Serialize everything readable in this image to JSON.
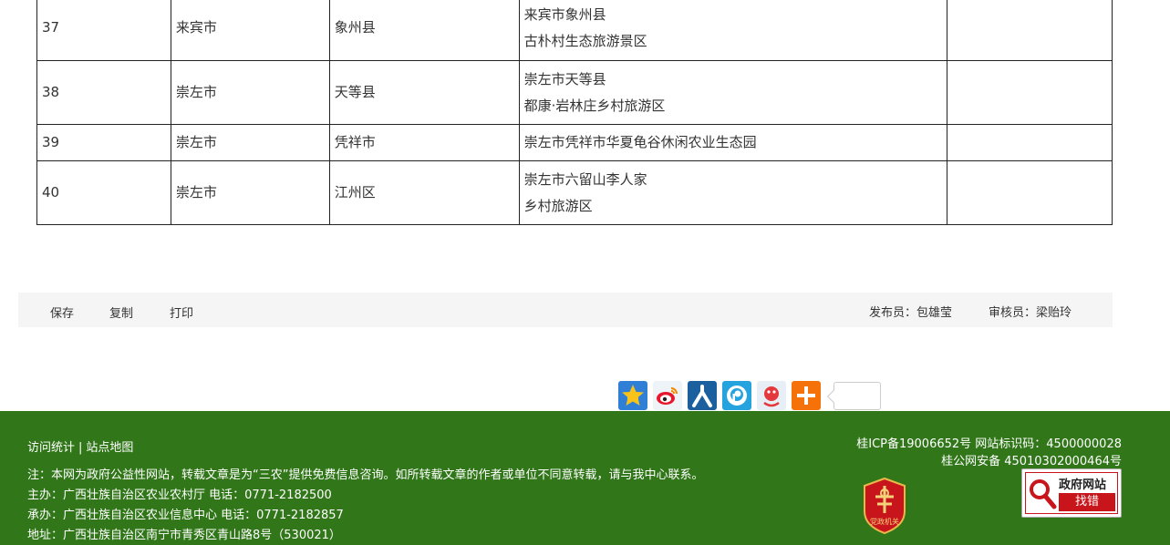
{
  "table": {
    "rows": [
      {
        "no": "37",
        "city": "来宾市",
        "county": "象州县",
        "name_lines": [
          "来宾市象州县",
          "古朴村生态旅游景区"
        ],
        "note": ""
      },
      {
        "no": "38",
        "city": "崇左市",
        "county": "天等县",
        "name_lines": [
          "崇左市天等县",
          "都康·岩林庄乡村旅游区"
        ],
        "note": ""
      },
      {
        "no": "39",
        "city": "崇左市",
        "county": "凭祥市",
        "name_lines": [
          "崇左市凭祥市华夏龟谷休闲农业生态园"
        ],
        "note": ""
      },
      {
        "no": "40",
        "city": "崇左市",
        "county": "江州区",
        "name_lines": [
          "崇左市六留山李人家",
          "乡村旅游区"
        ],
        "note": ""
      }
    ]
  },
  "toolbar": {
    "save": "保存",
    "copy": "复制",
    "print": "打印",
    "publisher": "发布员：包雄莹",
    "reviewer": "审核员：梁贻玲"
  },
  "share": {
    "icons": [
      "qzone-icon",
      "weibo-icon",
      "renren-icon",
      "pengyou-icon",
      "tieba-icon",
      "more-icon"
    ]
  },
  "footer": {
    "visit_stats": "访问统计",
    "separator": "|",
    "sitemap": "站点地图",
    "notice": "注：本网为政府公益性网站，转载文章是为“三农”提供免费信息咨询。如所转载文章的作者或单位不同意转载，请与我中心联系。",
    "host": "主办：广西壮族自治区农业农村厅 电话：0771-2182500",
    "organizer": "承办：广西壮族自治区农业信息中心 电话：0771-2182857",
    "address": "地址：广西壮族自治区南宁市青秀区青山路8号（530021）",
    "icp": "桂ICP备19006652号 网站标识码：4500000028",
    "police": "桂公网安备 45010302000464号",
    "badge_text": "党政机关",
    "finder_title": "政府网站",
    "finder_action": "找错"
  },
  "colors": {
    "footer_bg": "#31771a",
    "toolbar_bg": "#f5f5f5",
    "finder_red": "#c8151b"
  }
}
